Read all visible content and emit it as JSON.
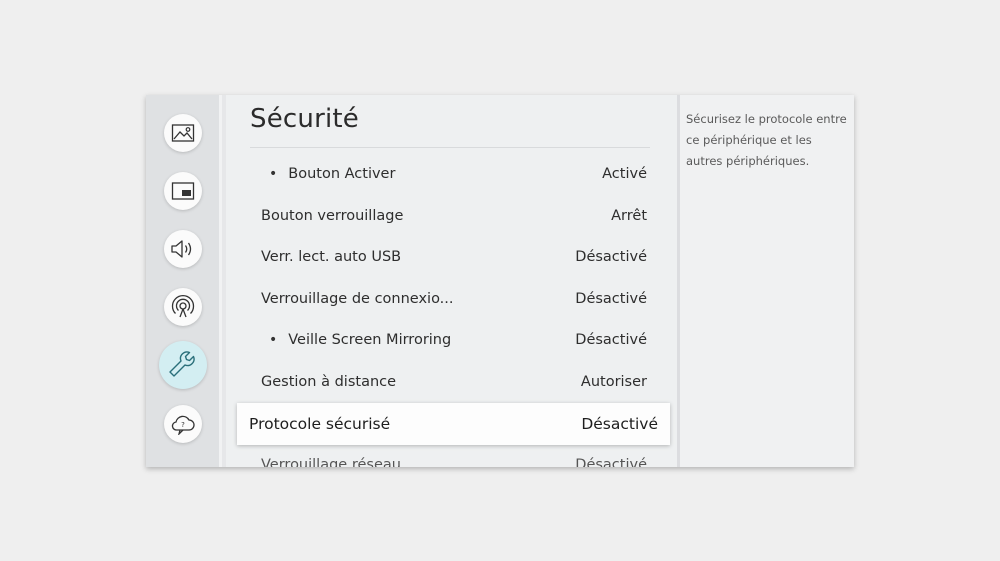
{
  "sidebar": {
    "items": [
      {
        "icon": "picture-icon",
        "selected": false
      },
      {
        "icon": "picture-in-picture-icon",
        "selected": false
      },
      {
        "icon": "sound-icon",
        "selected": false
      },
      {
        "icon": "broadcast-icon",
        "selected": false
      },
      {
        "icon": "wrench-icon",
        "selected": true
      },
      {
        "icon": "support-cloud-icon",
        "selected": false
      }
    ]
  },
  "page": {
    "title": "Sécurité"
  },
  "menu": {
    "rows": [
      {
        "label": "Bouton Activer",
        "value": "Activé",
        "bullet": true
      },
      {
        "label": "Bouton verrouillage",
        "value": "Arrêt",
        "bullet": false
      },
      {
        "label": "Verr. lect. auto USB",
        "value": "Désactivé",
        "bullet": false
      },
      {
        "label": "Verrouillage de connexio...",
        "value": "Désactivé",
        "bullet": false
      },
      {
        "label": "Veille Screen Mirroring",
        "value": "Désactivé",
        "bullet": true
      },
      {
        "label": "Gestion à distance",
        "value": "Autoriser",
        "bullet": false
      },
      {
        "label": "Protocole sécurisé",
        "value": "Désactivé",
        "bullet": false,
        "focused": true
      },
      {
        "label": "Verrouillage réseau",
        "value": "Désactivé",
        "bullet": false
      }
    ]
  },
  "info": {
    "description": "Sécurisez le protocole entre ce périphérique et les autres périphériques."
  },
  "colors": {
    "accent_selected": "#d3eef2",
    "focus_bg": "#fdfdfd",
    "icon_stroke": "#333333"
  }
}
